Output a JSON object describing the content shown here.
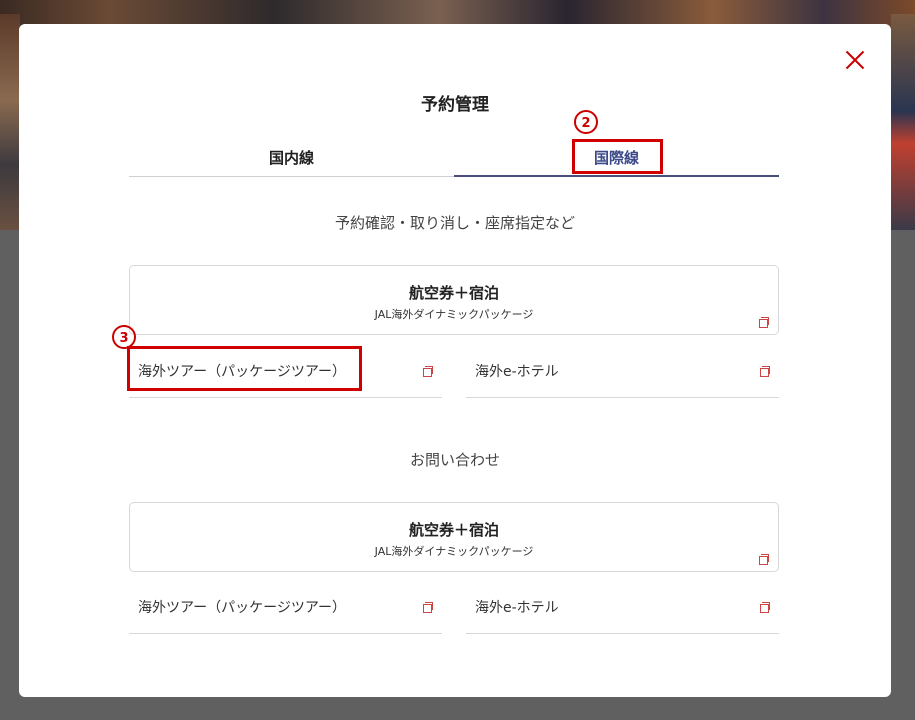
{
  "modal": {
    "title": "予約管理",
    "close_icon": "close-icon"
  },
  "markers": {
    "two": "2",
    "three": "3"
  },
  "tabs": [
    {
      "label": "国内線",
      "active": false
    },
    {
      "label": "国際線",
      "active": true
    }
  ],
  "sections": [
    {
      "heading": "予約確認・取り消し・座席指定など",
      "card": {
        "title": "航空券＋宿泊",
        "subtitle": "JAL海外ダイナミックパッケージ"
      },
      "links": [
        {
          "label": "海外ツアー（パッケージツアー）"
        },
        {
          "label": "海外e-ホテル"
        }
      ]
    },
    {
      "heading": "お問い合わせ",
      "card": {
        "title": "航空券＋宿泊",
        "subtitle": "JAL海外ダイナミックパッケージ"
      },
      "links": [
        {
          "label": "海外ツアー（パッケージツアー）"
        },
        {
          "label": "海外e-ホテル"
        }
      ]
    }
  ],
  "colors": {
    "accent_red": "#cc0000",
    "tab_active": "#3c4a8a",
    "annotation_box": "#d00000"
  }
}
